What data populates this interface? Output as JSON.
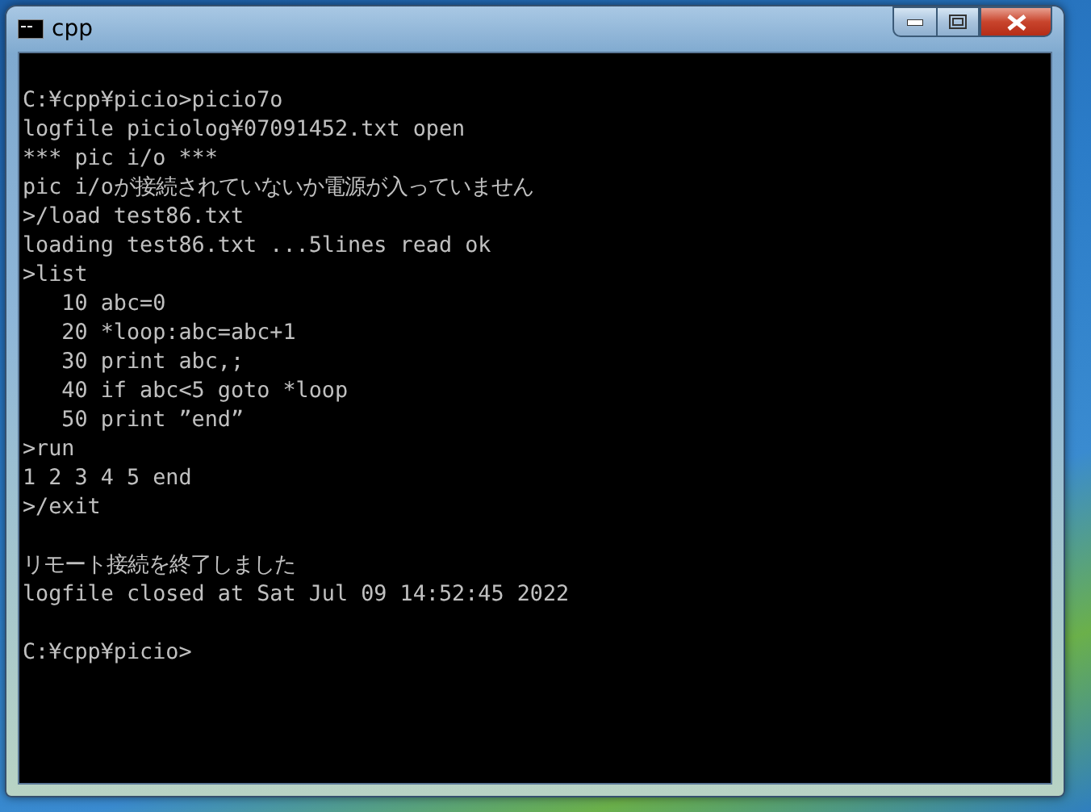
{
  "window": {
    "title": "cpp"
  },
  "console": {
    "blocks": [
      [
        "C:¥cpp¥picio>picio7o",
        "logfile piciolog¥07091452.txt open",
        "*** pic i/o ***",
        "pic i/oが接続されていないか電源が入っていません",
        ">/load test86.txt",
        "loading test86.txt ...5lines read ok",
        ">list",
        "   10 abc=0",
        "   20 *loop:abc=abc+1",
        "   30 print abc,;",
        "   40 if abc<5 goto *loop",
        "   50 print ”end”",
        ">run",
        "1 2 3 4 5 end",
        ">/exit"
      ],
      [
        "リモート接続を終了しました",
        "logfile closed at Sat Jul 09 14:52:45 2022"
      ],
      [
        "C:¥cpp¥picio>"
      ]
    ]
  }
}
